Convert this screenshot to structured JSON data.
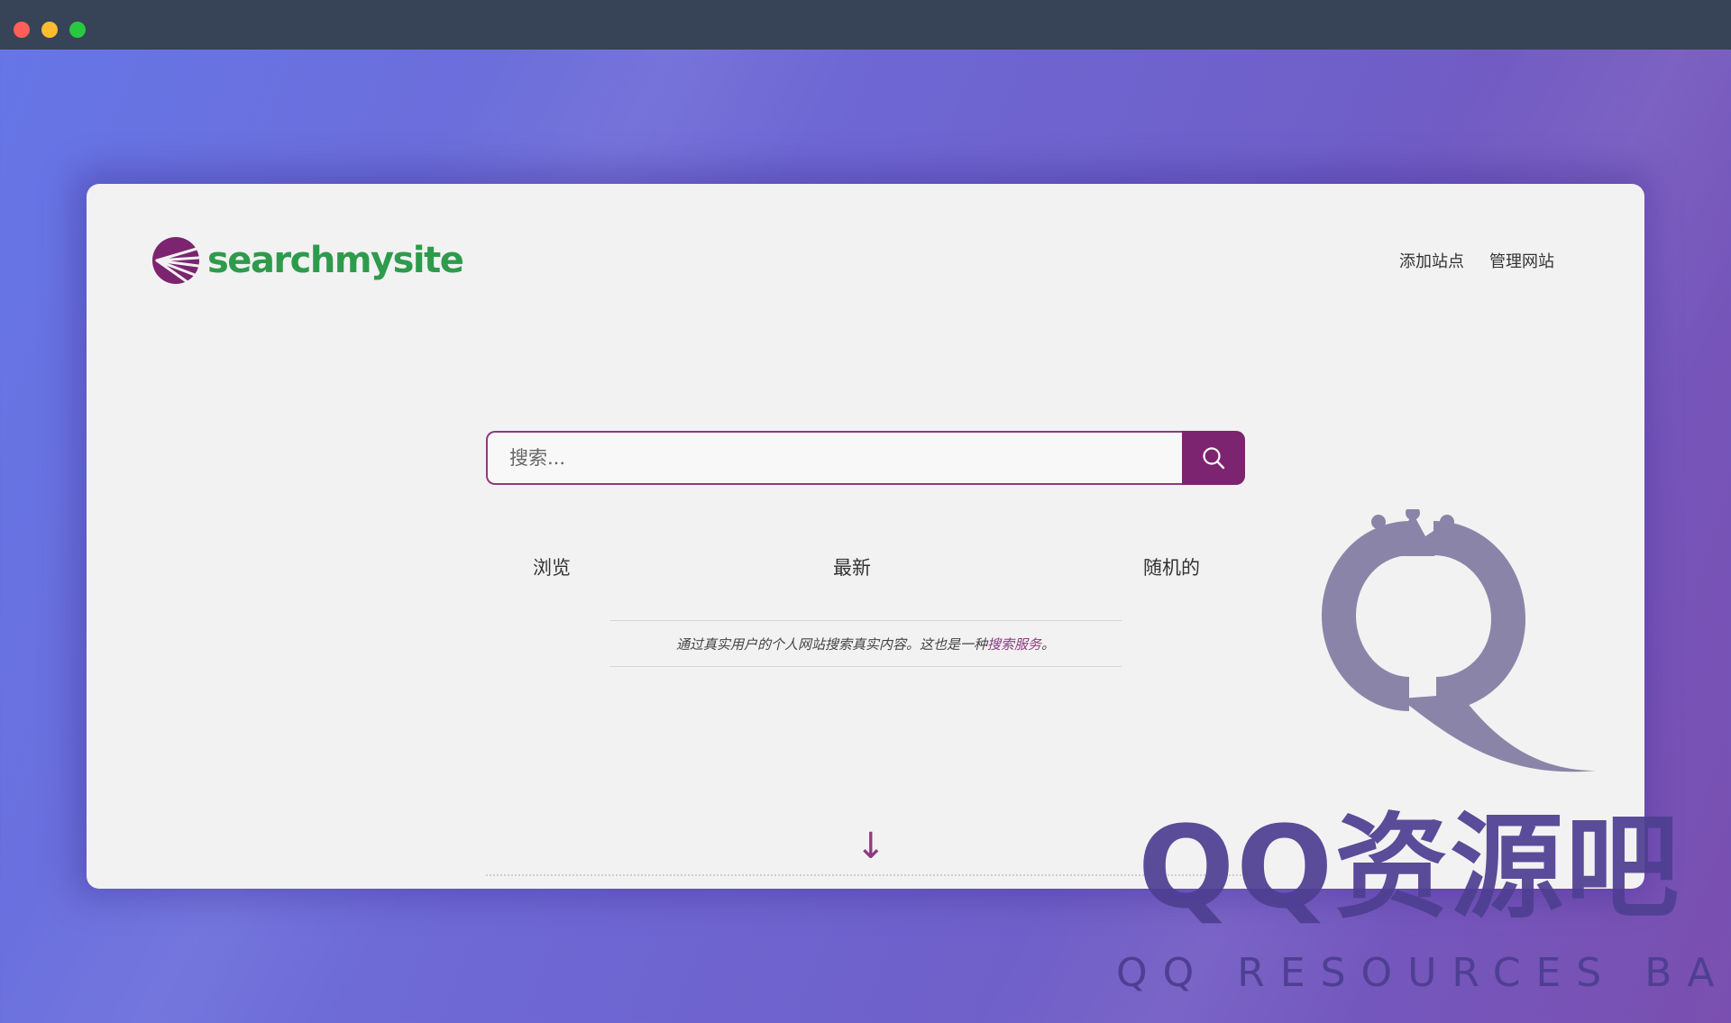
{
  "window": {
    "controls": [
      "close",
      "minimize",
      "maximize"
    ]
  },
  "site": {
    "logo_text": "searchmysite",
    "logo_color": "#2e9b4c",
    "accent_color": "#7c2470",
    "nav": {
      "add_site": "添加站点",
      "manage_site": "管理网站"
    },
    "search": {
      "placeholder": "搜索...",
      "button_icon": "search-icon"
    },
    "tabs": {
      "browse": "浏览",
      "newest": "最新",
      "random": "随机的"
    },
    "tagline": {
      "text": "通过真实用户的个人网站搜索真实内容。这也是一种",
      "link": "搜索服务",
      "end": "。"
    },
    "scroll_icon": "↓"
  },
  "watermark": {
    "title": "QQ资源吧",
    "subtitle": "QQ RESOURCES BAR"
  }
}
